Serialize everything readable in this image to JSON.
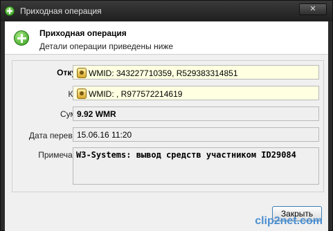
{
  "window": {
    "title": "Приходная операция",
    "close_glyph": "✕"
  },
  "header": {
    "title": "Приходная операция",
    "subtitle": "Детали операции приведены ниже"
  },
  "rows": [
    {
      "label": "Откуда:",
      "value": "WMID: 343227710359, R529383314851"
    },
    {
      "label": "Куда:",
      "value": "WMID: , R977572214619"
    },
    {
      "label": "Сумма:",
      "value": "9.92 WMR"
    },
    {
      "label": "Дата перевода:",
      "value": "15.06.16 11:20"
    },
    {
      "label": "Примечание:",
      "value": "W3-Systems: вывод средств участником ID29084"
    }
  ],
  "buttons": {
    "close": "Закрыть"
  },
  "watermark": "clip2net.com",
  "colors": {
    "accent": "#3c7fb1",
    "field_highlight": "#ffffe1"
  }
}
